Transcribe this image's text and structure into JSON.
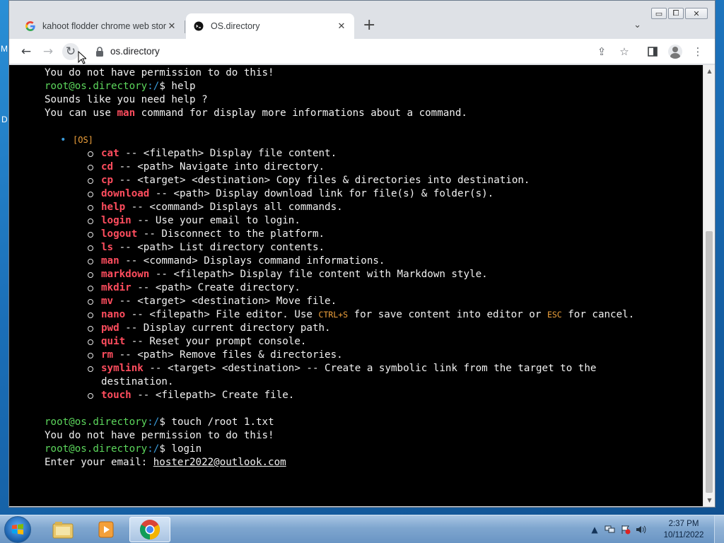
{
  "desktop": {
    "left_edge_letters": [
      "M",
      "D"
    ]
  },
  "browser": {
    "window_controls": {
      "minimize": "▭",
      "maximize": "⧠",
      "close": "✕"
    },
    "tabs": [
      {
        "title": "kahoot flodder chrome web store",
        "favicon": "google-g-icon",
        "active": false
      },
      {
        "title": "OS.directory",
        "favicon": "os-directory-icon",
        "active": true
      }
    ],
    "tab_close_glyph": "✕",
    "new_tab_glyph": "+",
    "tab_search_glyph": "⌄",
    "nav": {
      "back": "←",
      "forward": "→",
      "reload": "↻"
    },
    "url": "os.directory",
    "toolbar_icons": {
      "share": "⇪",
      "star": "☆",
      "menu": "⋮"
    }
  },
  "terminal": {
    "prompt_user": "root@os.directory",
    "prompt_path": ":/",
    "prompt_symbol": "$",
    "line_permission_1": "You do not have permission to do this!",
    "cmd_help": " help",
    "help_intro": "Sounds like you need help ?",
    "help_intro2_a": "You can use ",
    "help_intro2_man": "man",
    "help_intro2_b": " command for display more informations about a command.",
    "os_tag": "[OS]",
    "commands": [
      {
        "name": "cat",
        "desc": " -- <filepath> Display file content."
      },
      {
        "name": "cd",
        "desc": " -- <path> Navigate into directory."
      },
      {
        "name": "cp",
        "desc": " -- <target> <destination> Copy files & directories into destination."
      },
      {
        "name": "download",
        "desc": " -- <path> Display download link for file(s) & folder(s)."
      },
      {
        "name": "help",
        "desc": " -- <command> Displays all commands."
      },
      {
        "name": "login",
        "desc": " -- Use your email to login."
      },
      {
        "name": "logout",
        "desc": " -- Disconnect to the platform."
      },
      {
        "name": "ls",
        "desc": " -- <path> List directory contents."
      },
      {
        "name": "man",
        "desc": " -- <command> Displays command informations."
      },
      {
        "name": "markdown",
        "desc": " -- <filepath> Display file content with Markdown style."
      },
      {
        "name": "mkdir",
        "desc": " -- <path> Create directory."
      },
      {
        "name": "mv",
        "desc": " -- <target> <destination> Move file."
      }
    ],
    "nano": {
      "name": "nano",
      "desc_a": " -- <filepath> File editor. Use ",
      "key1": "CTRL+S",
      "desc_b": " for save content into editor or ",
      "key2": "ESC",
      "desc_c": " for cancel."
    },
    "commands2": [
      {
        "name": "pwd",
        "desc": " -- Display current directory path."
      },
      {
        "name": "quit",
        "desc": " -- Reset your prompt console."
      },
      {
        "name": "rm",
        "desc": " -- <path> Remove files & directories."
      },
      {
        "name": "symlink",
        "desc": " -- <target> <destination> -- Create a symbolic link from the target to the destination."
      },
      {
        "name": "touch",
        "desc": " -- <filepath> Create file."
      }
    ],
    "cmd_touch": " touch /root 1.txt",
    "line_permission_2": "You do not have permission to do this!",
    "cmd_login": " login",
    "email_prompt": "Enter your email: ",
    "email_value": "hoster2022@outlook.com"
  },
  "scrollbar": {
    "up": "▲",
    "down": "▼"
  },
  "taskbar": {
    "clock_time": "2:37 PM",
    "clock_date": "10/11/2022",
    "tray_show_hidden": "▲"
  }
}
